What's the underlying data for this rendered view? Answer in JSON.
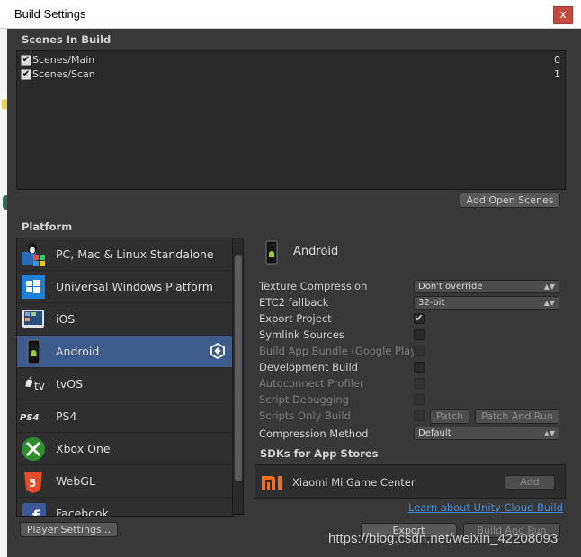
{
  "window": {
    "title": "Build Settings",
    "close_glyph": "x"
  },
  "scenes": {
    "header": "Scenes In Build",
    "items": [
      {
        "name": "Scenes/Main",
        "index": "0",
        "checked": true
      },
      {
        "name": "Scenes/Scan",
        "index": "1",
        "checked": true
      }
    ],
    "add_open_scenes": "Add Open Scenes"
  },
  "platform": {
    "header": "Platform",
    "items": [
      {
        "label": "PC, Mac & Linux Standalone",
        "icon": "pc-mac-linux-icon"
      },
      {
        "label": "Universal Windows Platform",
        "icon": "windows-icon"
      },
      {
        "label": "iOS",
        "icon": "ios-icon"
      },
      {
        "label": "Android",
        "icon": "android-icon",
        "selected": true
      },
      {
        "label": "tvOS",
        "icon": "tvos-icon"
      },
      {
        "label": "PS4",
        "icon": "ps4-icon"
      },
      {
        "label": "Xbox One",
        "icon": "xbox-icon"
      },
      {
        "label": "WebGL",
        "icon": "html5-icon"
      },
      {
        "label": "Facebook",
        "icon": "facebook-icon"
      }
    ]
  },
  "settings": {
    "platform_title": "Android",
    "texture_compression": {
      "label": "Texture Compression",
      "value": "Don't override"
    },
    "etc2_fallback": {
      "label": "ETC2 fallback",
      "value": "32-bit"
    },
    "export_project": {
      "label": "Export Project",
      "checked": true
    },
    "symlink_sources": {
      "label": "Symlink Sources",
      "checked": false
    },
    "build_app_bundle": {
      "label": "Build App Bundle (Google Play)",
      "checked": false
    },
    "development_build": {
      "label": "Development Build",
      "checked": false
    },
    "autoconnect_profiler": {
      "label": "Autoconnect Profiler",
      "checked": false
    },
    "script_debugging": {
      "label": "Script Debugging",
      "checked": false
    },
    "scripts_only_build": {
      "label": "Scripts Only Build",
      "checked": false
    },
    "patch": "Patch",
    "patch_and_run": "Patch And Run",
    "compression_method": {
      "label": "Compression Method",
      "value": "Default"
    }
  },
  "sdks": {
    "header": "SDKs for App Stores",
    "items": [
      {
        "name": "Xiaomi Mi Game Center",
        "button": "Add"
      }
    ],
    "learn_link": "Learn about Unity Cloud Build"
  },
  "footer": {
    "player_settings": "Player Settings...",
    "export": "Export",
    "build_and_run": "Build And Run"
  },
  "watermark": "https://blog.csdn.net/weixin_42208093",
  "colors": {
    "selection": "#3d5c8d",
    "link": "#4b8cd6",
    "panel": "#383838"
  }
}
